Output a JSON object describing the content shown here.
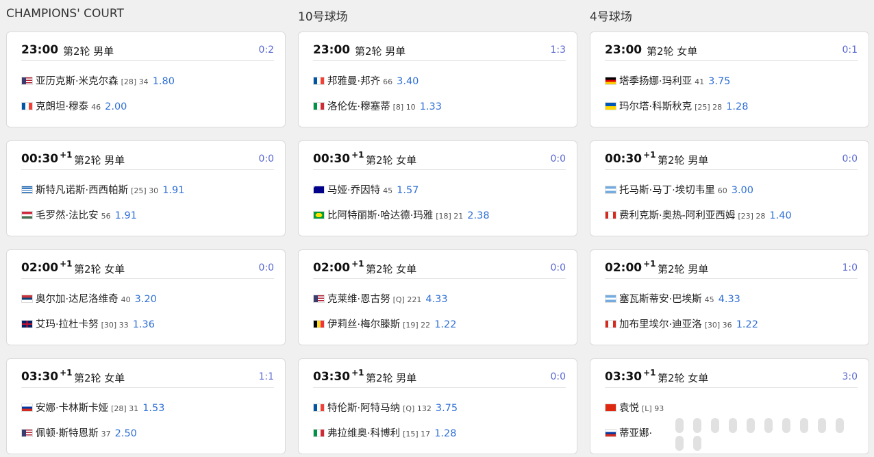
{
  "courts": [
    {
      "title": "CHAMPIONS' COURT",
      "matches": [
        {
          "time": "23:00",
          "plus": "",
          "round": "第2轮 男单",
          "score": "0:2",
          "players": [
            {
              "flag": "us",
              "name": "亚历克斯·米克尔森",
              "meta": "[28] 34",
              "odds": "1.80"
            },
            {
              "flag": "fr",
              "name": "克朗坦·穆泰",
              "meta": "46",
              "odds": "2.00"
            }
          ]
        },
        {
          "time": "00:30",
          "plus": "+1",
          "round": "第2轮 男单",
          "score": "0:0",
          "players": [
            {
              "flag": "gr",
              "name": "斯特凡诺斯·西西帕斯",
              "meta": "[25] 30",
              "odds": "1.91"
            },
            {
              "flag": "hu",
              "name": "毛罗然·法比安",
              "meta": "56",
              "odds": "1.91"
            }
          ]
        },
        {
          "time": "02:00",
          "plus": "+1",
          "round": "第2轮 女单",
          "score": "0:0",
          "players": [
            {
              "flag": "rs",
              "name": "奥尔加·达尼洛维奇",
              "meta": "40",
              "odds": "3.20"
            },
            {
              "flag": "gb",
              "name": "艾玛·拉杜卡努",
              "meta": "[30] 33",
              "odds": "1.36"
            }
          ]
        },
        {
          "time": "03:30",
          "plus": "+1",
          "round": "第2轮 女单",
          "score": "1:1",
          "players": [
            {
              "flag": "ru",
              "name": "安娜·卡林斯卡娅",
              "meta": "[28] 31",
              "odds": "1.53"
            },
            {
              "flag": "us",
              "name": "佩顿·斯特恩斯",
              "meta": "37",
              "odds": "2.50"
            }
          ]
        }
      ]
    },
    {
      "title": "10号球场",
      "matches": [
        {
          "time": "23:00",
          "plus": "",
          "round": "第2轮 男单",
          "score": "1:3",
          "players": [
            {
              "flag": "fr",
              "name": "邦雅曼·邦齐",
              "meta": "66",
              "odds": "3.40"
            },
            {
              "flag": "it",
              "name": "洛伦佐·穆塞蒂",
              "meta": "[8] 10",
              "odds": "1.33"
            }
          ]
        },
        {
          "time": "00:30",
          "plus": "+1",
          "round": "第2轮 女单",
          "score": "0:0",
          "players": [
            {
              "flag": "au",
              "name": "马娅·乔因特",
              "meta": "45",
              "odds": "1.57"
            },
            {
              "flag": "br",
              "name": "比阿特丽斯·哈达德·玛雅",
              "meta": "[18] 21",
              "odds": "2.38"
            }
          ]
        },
        {
          "time": "02:00",
          "plus": "+1",
          "round": "第2轮 女单",
          "score": "0:0",
          "players": [
            {
              "flag": "us",
              "name": "克莱维·恩古努",
              "meta": "[Q] 221",
              "odds": "4.33"
            },
            {
              "flag": "be",
              "name": "伊莉丝·梅尔滕斯",
              "meta": "[19] 22",
              "odds": "1.22"
            }
          ]
        },
        {
          "time": "03:30",
          "plus": "+1",
          "round": "第2轮 男单",
          "score": "0:0",
          "players": [
            {
              "flag": "fr",
              "name": "特伦斯·阿特马纳",
              "meta": "[Q] 132",
              "odds": "3.75"
            },
            {
              "flag": "it",
              "name": "弗拉维奥·科博利",
              "meta": "[15] 17",
              "odds": "1.28"
            }
          ]
        }
      ]
    },
    {
      "title": "4号球场",
      "matches": [
        {
          "time": "23:00",
          "plus": "",
          "round": "第2轮 女单",
          "score": "0:1",
          "players": [
            {
              "flag": "de",
              "name": "塔季扬娜·玛利亚",
              "meta": "41",
              "odds": "3.75"
            },
            {
              "flag": "ua",
              "name": "玛尔塔·科斯秋克",
              "meta": "[25] 28",
              "odds": "1.28"
            }
          ]
        },
        {
          "time": "00:30",
          "plus": "+1",
          "round": "第2轮 男单",
          "score": "0:0",
          "players": [
            {
              "flag": "ar",
              "name": "托马斯·马丁·埃切韦里",
              "meta": "60",
              "odds": "3.00"
            },
            {
              "flag": "ca",
              "name": "费利克斯·奥热-阿利亚西姆",
              "meta": "[23] 28",
              "odds": "1.40"
            }
          ]
        },
        {
          "time": "02:00",
          "plus": "+1",
          "round": "第2轮 男单",
          "score": "1:0",
          "players": [
            {
              "flag": "ar",
              "name": "塞瓦斯蒂安·巴埃斯",
              "meta": "45",
              "odds": "4.33"
            },
            {
              "flag": "ca",
              "name": "加布里埃尔·迪亚洛",
              "meta": "[30] 36",
              "odds": "1.22"
            }
          ]
        },
        {
          "time": "03:30",
          "plus": "+1",
          "round": "第2轮 女单",
          "score": "3:0",
          "players": [
            {
              "flag": "cn",
              "name": "袁悦",
              "meta": "[L] 93",
              "odds": ""
            },
            {
              "flag": "ru",
              "name": "蒂亚娜·",
              "meta": "",
              "odds": ""
            }
          ]
        }
      ]
    }
  ],
  "flag_colors": {
    "us": "#3c3b6e",
    "fr": "#0055a4",
    "gr": "#0d5eaf",
    "hu": "#477050",
    "rs": "#c6363c",
    "gb": "#012169",
    "ru": "#0039a6",
    "it": "#009246",
    "au": "#00008b",
    "br": "#009c3b",
    "be": "#fdda24",
    "de": "#000000",
    "ua": "#0057b7",
    "ar": "#74acdf",
    "ca": "#d52b1e",
    "cn": "#de2910"
  }
}
